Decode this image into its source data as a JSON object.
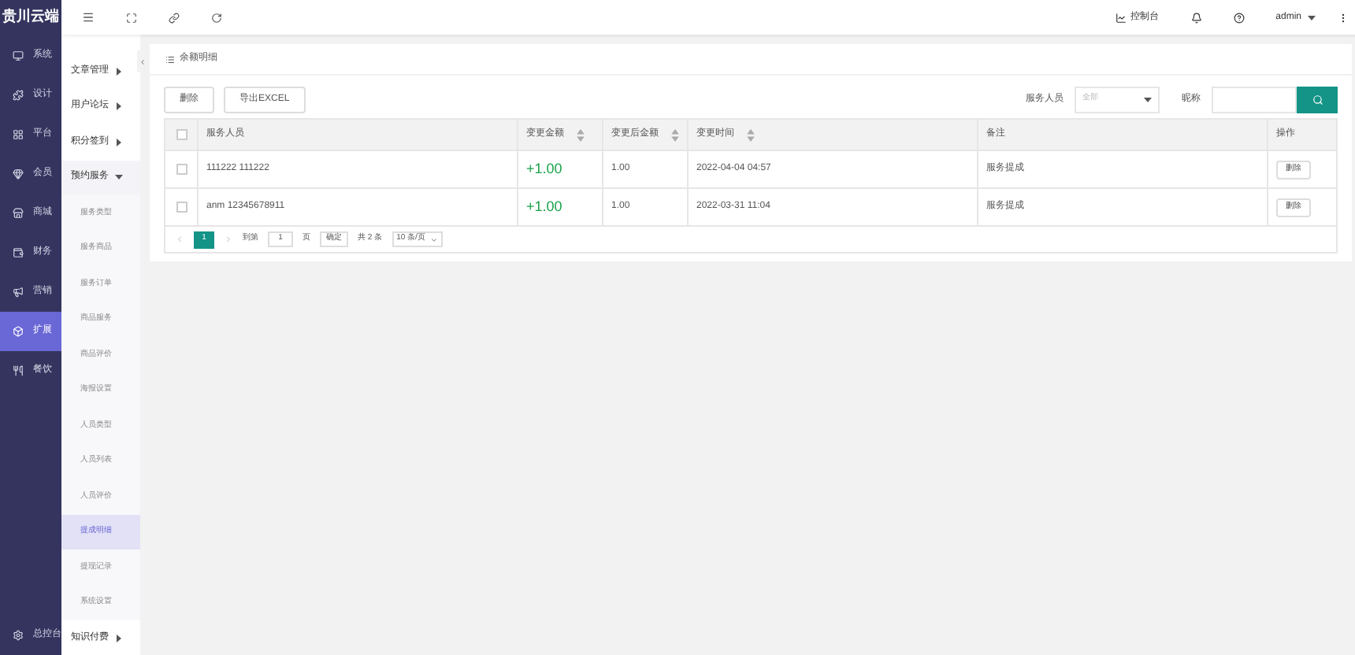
{
  "logo": "贵川云端",
  "main_nav": [
    {
      "label": "系统",
      "selected": false
    },
    {
      "label": "设计",
      "selected": false
    },
    {
      "label": "平台",
      "selected": false
    },
    {
      "label": "会员",
      "selected": false
    },
    {
      "label": "商城",
      "selected": false
    },
    {
      "label": "财务",
      "selected": false
    },
    {
      "label": "营销",
      "selected": false
    },
    {
      "label": "扩展",
      "selected": true
    },
    {
      "label": "餐饮",
      "selected": false
    }
  ],
  "main_nav_bottom": {
    "label": "总控台"
  },
  "sub_nav": [
    {
      "label": "文章管理",
      "expanded": false
    },
    {
      "label": "用户论坛",
      "expanded": false
    },
    {
      "label": "积分签到",
      "expanded": false
    },
    {
      "label": "预约服务",
      "expanded": true,
      "children": [
        {
          "label": "服务类型",
          "selected": false
        },
        {
          "label": "服务商品",
          "selected": false
        },
        {
          "label": "服务订单",
          "selected": false
        },
        {
          "label": "商品服务",
          "selected": false
        },
        {
          "label": "商品评价",
          "selected": false
        },
        {
          "label": "海报设置",
          "selected": false
        },
        {
          "label": "人员类型",
          "selected": false
        },
        {
          "label": "人员列表",
          "selected": false
        },
        {
          "label": "人员评价",
          "selected": false
        },
        {
          "label": "提成明细",
          "selected": true
        },
        {
          "label": "提现记录",
          "selected": false
        },
        {
          "label": "系统设置",
          "selected": false
        }
      ]
    },
    {
      "label": "知识付费",
      "expanded": false
    }
  ],
  "topbar": {
    "console": "控制台",
    "user": "admin"
  },
  "card": {
    "title": "余额明细",
    "buttons": [
      "删除",
      "导出EXCEL"
    ],
    "filters": [
      {
        "label": "服务人员",
        "kind": "select",
        "placeholder": "全部"
      },
      {
        "label": "昵称",
        "kind": "input"
      }
    ],
    "table": {
      "select_all_checked": false,
      "columns": [
        {
          "label": "服务人员",
          "sortable": false
        },
        {
          "label": "变更金额",
          "sortable": true
        },
        {
          "label": "变更后金额",
          "sortable": true
        },
        {
          "label": "变更时间",
          "sortable": true
        },
        {
          "label": "备注",
          "sortable": false
        },
        {
          "label": "操作",
          "sortable": false
        }
      ],
      "rows": [
        {
          "checked": false,
          "cells": [
            "111222 111222",
            "+1.00",
            "1.00",
            "2022-04-04 04:57",
            "服务提成"
          ],
          "action": "删除"
        },
        {
          "checked": false,
          "cells": [
            "anm 12345678911",
            "+1.00",
            "1.00",
            "2022-03-31 11:04",
            "服务提成"
          ],
          "action": "删除"
        }
      ]
    },
    "pagination": {
      "pages": [
        {
          "label": "1",
          "selected": true
        }
      ],
      "goto_label": "到第",
      "goto_value": "1",
      "page_unit": "页",
      "confirm": "确定",
      "total": "共 2 条",
      "page_size": "10 条/页"
    }
  }
}
